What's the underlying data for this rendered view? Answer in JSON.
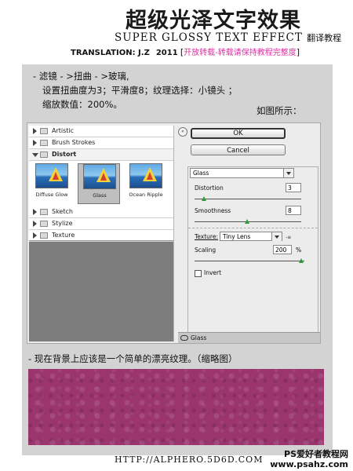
{
  "header": {
    "title_cn": "超级光泽文字效果",
    "title_en": "SUPER GLOSSY TEXT EFFECT",
    "title_en_suffix": "翻译教程",
    "translation": "TRANSLATION: J.Z",
    "year": "2011",
    "bracket_open": "[",
    "bracket_close": "]",
    "repost_note": "开放转载-转载请保持教程完整度"
  },
  "instructions": {
    "line1": "- 滤镜 - >扭曲 - >玻璃,",
    "line2": "设置扭曲度为3；平滑度8；纹理选择：小镜头 ；",
    "line3": "缩放数值：200%。",
    "caption": "如图所示："
  },
  "dialog": {
    "tree": [
      {
        "label": "Artistic",
        "open": false
      },
      {
        "label": "Brush Strokes",
        "open": false
      },
      {
        "label": "Distort",
        "open": true
      }
    ],
    "thumbs": [
      "Diffuse Glow",
      "Glass",
      "Ocean Ripple"
    ],
    "selected_thumb": "Glass",
    "tree_after": [
      "Sketch",
      "Stylize",
      "Texture"
    ],
    "collapse_glyph": "«",
    "ok_label": "OK",
    "cancel_label": "Cancel",
    "filter_select": "Glass",
    "distortion_label": "Distortion",
    "distortion_value": "3",
    "smoothness_label": "Smoothness",
    "smoothness_value": "8",
    "texture_label": "Texture:",
    "texture_value": "Tiny Lens",
    "texture_menu_glyph": "-≡",
    "scaling_label": "Scaling",
    "scaling_value": "200",
    "scaling_unit": "%",
    "invert_label": "Invert",
    "layer_label": "Glass"
  },
  "result": {
    "text": "- 现在背景上应该是一个简单的漂亮纹理。（缩略图）",
    "texture_color": "#9a356e"
  },
  "footer": {
    "url": "HTTP://ALPHERO.5D6D.COM",
    "watermark_line1": "PS爱好者教程网",
    "watermark_line2": "www.psahz.com"
  }
}
